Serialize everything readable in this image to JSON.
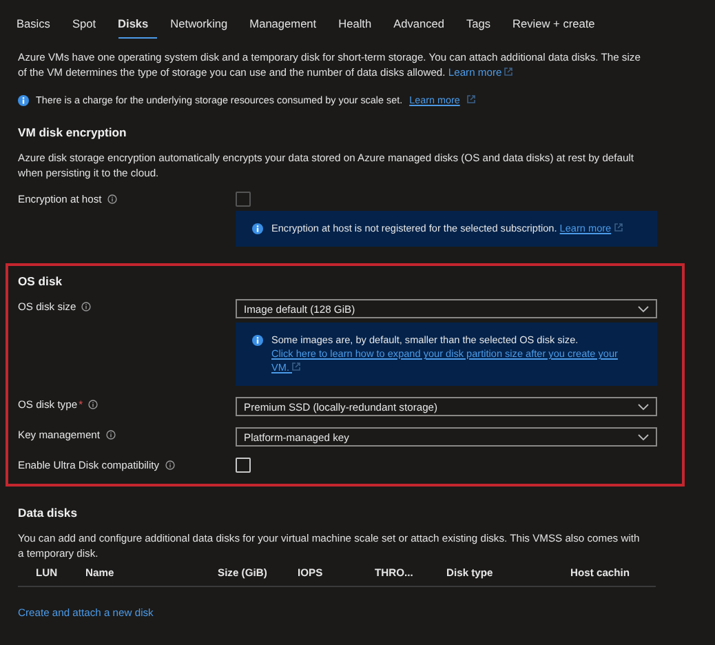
{
  "tabs": [
    {
      "label": "Basics",
      "selected": false
    },
    {
      "label": "Spot",
      "selected": false
    },
    {
      "label": "Disks",
      "selected": true
    },
    {
      "label": "Networking",
      "selected": false
    },
    {
      "label": "Management",
      "selected": false
    },
    {
      "label": "Health",
      "selected": false
    },
    {
      "label": "Advanced",
      "selected": false
    },
    {
      "label": "Tags",
      "selected": false
    },
    {
      "label": "Review + create",
      "selected": false
    }
  ],
  "intro": {
    "text": "Azure VMs have one operating system disk and a temporary disk for short-term storage. You can attach additional data disks. The size of the VM determines the type of storage you can use and the number of data disks allowed.",
    "link": "Learn more"
  },
  "notice": {
    "text": "There is a charge for the underlying storage resources consumed by your scale set.",
    "link": "Learn more"
  },
  "encryption": {
    "title": "VM disk encryption",
    "description": "Azure disk storage encryption automatically encrypts your data stored on Azure managed disks (OS and data disks) at rest by default when persisting it to the cloud.",
    "fields": [
      {
        "kind": "checkbox",
        "label": "Encryption at host",
        "checked": false,
        "disabled": true,
        "info": {
          "text": "Encryption at host is not registered for the selected subscription.",
          "link": "Learn more"
        }
      }
    ]
  },
  "os_disk": {
    "title": "OS disk",
    "fields": [
      {
        "kind": "dropdown",
        "label": "OS disk size",
        "value": "Image default (128 GiB)",
        "info": {
          "text": "Some images are, by default, smaller than the selected OS disk size.",
          "link": "Click here to learn how to expand your disk partition size after you create your VM."
        }
      },
      {
        "kind": "dropdown",
        "label": "OS disk type",
        "required_mark": "*",
        "value": "Premium SSD (locally-redundant storage)"
      },
      {
        "kind": "dropdown",
        "label": "Key management",
        "value": "Platform-managed key"
      },
      {
        "kind": "checkbox",
        "label": "Enable Ultra Disk compatibility",
        "checked": false,
        "disabled": false
      }
    ]
  },
  "data_disks": {
    "title": "Data disks",
    "description": "You can add and configure additional data disks for your virtual machine scale set or attach existing disks. This VMSS also comes with a temporary disk.",
    "columns": [
      "LUN",
      "Name",
      "Size (GiB)",
      "IOPS",
      "THRO...",
      "Disk type",
      "Host cachin"
    ],
    "link": "Create and attach a new disk"
  }
}
